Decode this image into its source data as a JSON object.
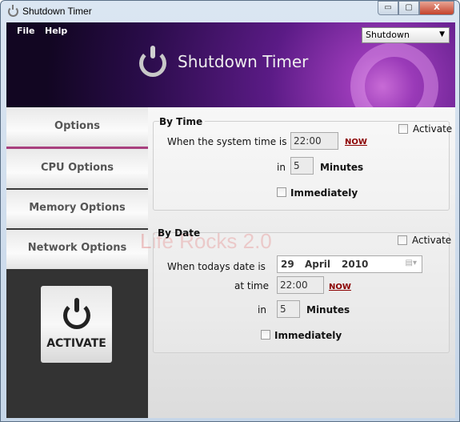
{
  "window": {
    "title": "Shutdown Timer",
    "minimize": "▭",
    "maximize": "▢",
    "close": "X"
  },
  "menu": {
    "file": "File",
    "help": "Help"
  },
  "header": {
    "title": "Shutdown Timer",
    "action_select": "Shutdown"
  },
  "sidebar": {
    "tabs": [
      {
        "label": "Options",
        "active": true
      },
      {
        "label": "CPU Options"
      },
      {
        "label": "Memory Options"
      },
      {
        "label": "Network Options"
      }
    ],
    "activate": "ACTIVATE"
  },
  "by_time": {
    "title": "By Time",
    "activate": "Activate",
    "system_time_label": "When the system time is",
    "time": "22:00",
    "now": "NOW",
    "in_label": "in",
    "minutes_value": "5",
    "minutes_label": "Minutes",
    "immediately": "Immediately"
  },
  "by_date": {
    "title": "By Date",
    "activate": "Activate",
    "date_label": "When todays date is",
    "day": "29",
    "month": "April",
    "year": "2010",
    "at_time_label": "at time",
    "time": "22:00",
    "now": "NOW",
    "in_label": "in",
    "minutes_value": "5",
    "minutes_label": "Minutes",
    "immediately": "Immediately"
  },
  "watermark": "Life Rocks 2.0",
  "colors": {
    "accent": "#a8407e",
    "link": "#8b0000",
    "header": "#5b1b86"
  }
}
